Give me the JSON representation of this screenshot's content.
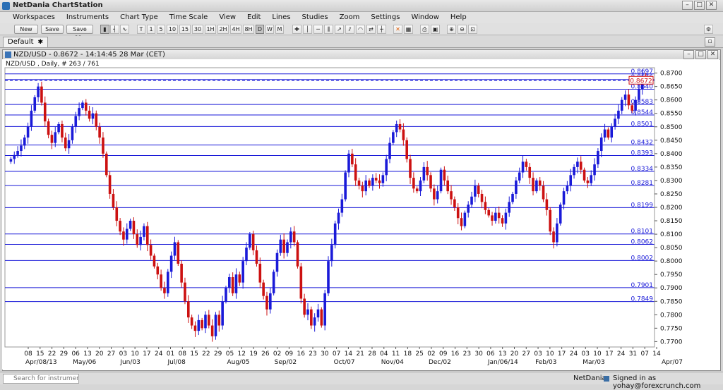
{
  "app": {
    "title": "NetDania ChartStation"
  },
  "menu": [
    "Workspaces",
    "Instruments",
    "Chart Type",
    "Time Scale",
    "View",
    "Edit",
    "Lines",
    "Studies",
    "Zoom",
    "Settings",
    "Window",
    "Help"
  ],
  "toolbar": {
    "new_label": "New",
    "save_label": "Save",
    "saveas_label": "Save as..",
    "chart_type_icons": [
      "candles-icon",
      "bars-icon",
      "line-icon"
    ],
    "timescales": [
      "T",
      "1",
      "5",
      "10",
      "15",
      "30",
      "1H",
      "2H",
      "4H",
      "8H",
      "D",
      "W",
      "M"
    ],
    "selected_timescale": "D",
    "tools": [
      "crosshair-icon",
      "vertical-line-icon",
      "horizontal-line-icon",
      "fibonacci-icon",
      "trend-icon",
      "channel-icon",
      "cycle-icon",
      "arrows-icon",
      "ruler-icon",
      "delete-icon",
      "clear-icon",
      "print-icon",
      "camera-icon",
      "zoom-in-icon",
      "zoom-out-icon",
      "zoom-fit-icon"
    ]
  },
  "tabs": [
    {
      "label": "Default",
      "close": "✱"
    }
  ],
  "chart_window": {
    "title": "NZD/USD - 0.8672 - 14:14:45  28 Mar (CET)",
    "subtitle": "NZD/USD , Daily, # 263 / 761"
  },
  "chart_data": {
    "type": "candlestick",
    "instrument": "NZD/USD",
    "interval": "Daily",
    "last_price": "0.8672",
    "y_ticks": [
      "0.8700",
      "0.8650",
      "0.8600",
      "0.8550",
      "0.8500",
      "0.8450",
      "0.8400",
      "0.8350",
      "0.8300",
      "0.8250",
      "0.8200",
      "0.8150",
      "0.8100",
      "0.8050",
      "0.8000",
      "0.7950",
      "0.7900",
      "0.7850",
      "0.7800",
      "0.7750",
      "0.7700"
    ],
    "ylim": [
      0.768,
      0.872
    ],
    "x_day_labels": [
      "08",
      "15",
      "22",
      "29",
      "06",
      "13",
      "20",
      "27",
      "03",
      "10",
      "17",
      "24",
      "01",
      "08",
      "15",
      "22",
      "29",
      "05",
      "12",
      "19",
      "26",
      "02",
      "09",
      "16",
      "23",
      "30",
      "07",
      "14",
      "21",
      "28",
      "04",
      "11",
      "18",
      "25",
      "02",
      "09",
      "16",
      "23",
      "30",
      "06",
      "13",
      "20",
      "27",
      "03",
      "10",
      "17",
      "24",
      "03",
      "10",
      "17",
      "24",
      "31",
      "07",
      "14"
    ],
    "x_month_labels": [
      "Apr/08/13",
      "May/06",
      "Jun/03",
      "Jul/08",
      "Aug/05",
      "Sep/02",
      "Oct/07",
      "Nov/04",
      "Dec/02",
      "Jan/06/14",
      "Feb/03",
      "Mar/03",
      "Apr/07"
    ],
    "horizontal_lines": [
      {
        "label": "0.8697",
        "value": 0.8697
      },
      {
        "label": "0.8676",
        "value": 0.8676
      },
      {
        "label": "0.8640",
        "value": 0.864
      },
      {
        "label": "0.8583",
        "value": 0.8583
      },
      {
        "label": "0.8544",
        "value": 0.8544
      },
      {
        "label": "0.8501",
        "value": 0.8501
      },
      {
        "label": "0.8432",
        "value": 0.8432
      },
      {
        "label": "0.8393",
        "value": 0.8393
      },
      {
        "label": "0.8334",
        "value": 0.8334
      },
      {
        "label": "0.8281",
        "value": 0.8281
      },
      {
        "label": "0.8199",
        "value": 0.8199
      },
      {
        "label": "0.8101",
        "value": 0.8101
      },
      {
        "label": "0.8062",
        "value": 0.8062
      },
      {
        "label": "0.8002",
        "value": 0.8002
      },
      {
        "label": "0.7901",
        "value": 0.7901
      },
      {
        "label": "0.7849",
        "value": 0.7849
      }
    ],
    "price_line": {
      "label": "0.8672",
      "value": 0.8672
    },
    "closes": [
      0.838,
      0.8395,
      0.841,
      0.843,
      0.846,
      0.85,
      0.856,
      0.861,
      0.865,
      0.859,
      0.852,
      0.847,
      0.844,
      0.848,
      0.851,
      0.846,
      0.842,
      0.845,
      0.85,
      0.854,
      0.857,
      0.859,
      0.856,
      0.853,
      0.855,
      0.85,
      0.846,
      0.84,
      0.832,
      0.825,
      0.82,
      0.815,
      0.811,
      0.808,
      0.812,
      0.815,
      0.81,
      0.806,
      0.809,
      0.813,
      0.806,
      0.802,
      0.798,
      0.795,
      0.79,
      0.788,
      0.796,
      0.802,
      0.807,
      0.799,
      0.792,
      0.785,
      0.779,
      0.776,
      0.774,
      0.778,
      0.775,
      0.78,
      0.776,
      0.772,
      0.78,
      0.776,
      0.785,
      0.79,
      0.794,
      0.788,
      0.795,
      0.792,
      0.8,
      0.805,
      0.81,
      0.804,
      0.799,
      0.792,
      0.787,
      0.782,
      0.788,
      0.796,
      0.803,
      0.808,
      0.803,
      0.807,
      0.811,
      0.807,
      0.798,
      0.786,
      0.78,
      0.782,
      0.776,
      0.779,
      0.782,
      0.776,
      0.788,
      0.8,
      0.806,
      0.814,
      0.818,
      0.823,
      0.833,
      0.84,
      0.836,
      0.83,
      0.828,
      0.826,
      0.83,
      0.828,
      0.831,
      0.83,
      0.829,
      0.832,
      0.838,
      0.844,
      0.848,
      0.851,
      0.849,
      0.845,
      0.838,
      0.831,
      0.827,
      0.826,
      0.83,
      0.835,
      0.832,
      0.827,
      0.823,
      0.826,
      0.834,
      0.83,
      0.826,
      0.823,
      0.82,
      0.816,
      0.813,
      0.818,
      0.821,
      0.824,
      0.828,
      0.825,
      0.822,
      0.819,
      0.817,
      0.815,
      0.818,
      0.816,
      0.814,
      0.818,
      0.822,
      0.825,
      0.83,
      0.833,
      0.837,
      0.835,
      0.831,
      0.826,
      0.83,
      0.828,
      0.823,
      0.819,
      0.811,
      0.807,
      0.814,
      0.821,
      0.826,
      0.828,
      0.832,
      0.835,
      0.837,
      0.834,
      0.83,
      0.829,
      0.832,
      0.836,
      0.841,
      0.846,
      0.849,
      0.846,
      0.85,
      0.853,
      0.856,
      0.86,
      0.862,
      0.858,
      0.856,
      0.86,
      0.864,
      0.869,
      0.8672
    ]
  },
  "statusbar": {
    "search_placeholder": "Search for instrument",
    "brand": "NetDania",
    "signed_in": "Signed in as yohay@forexcrunch.com"
  },
  "colors": {
    "up": "#1a1ad8",
    "down": "#cc1111",
    "gridline": "#1a1ad8",
    "label_bg": "#ffffff"
  }
}
